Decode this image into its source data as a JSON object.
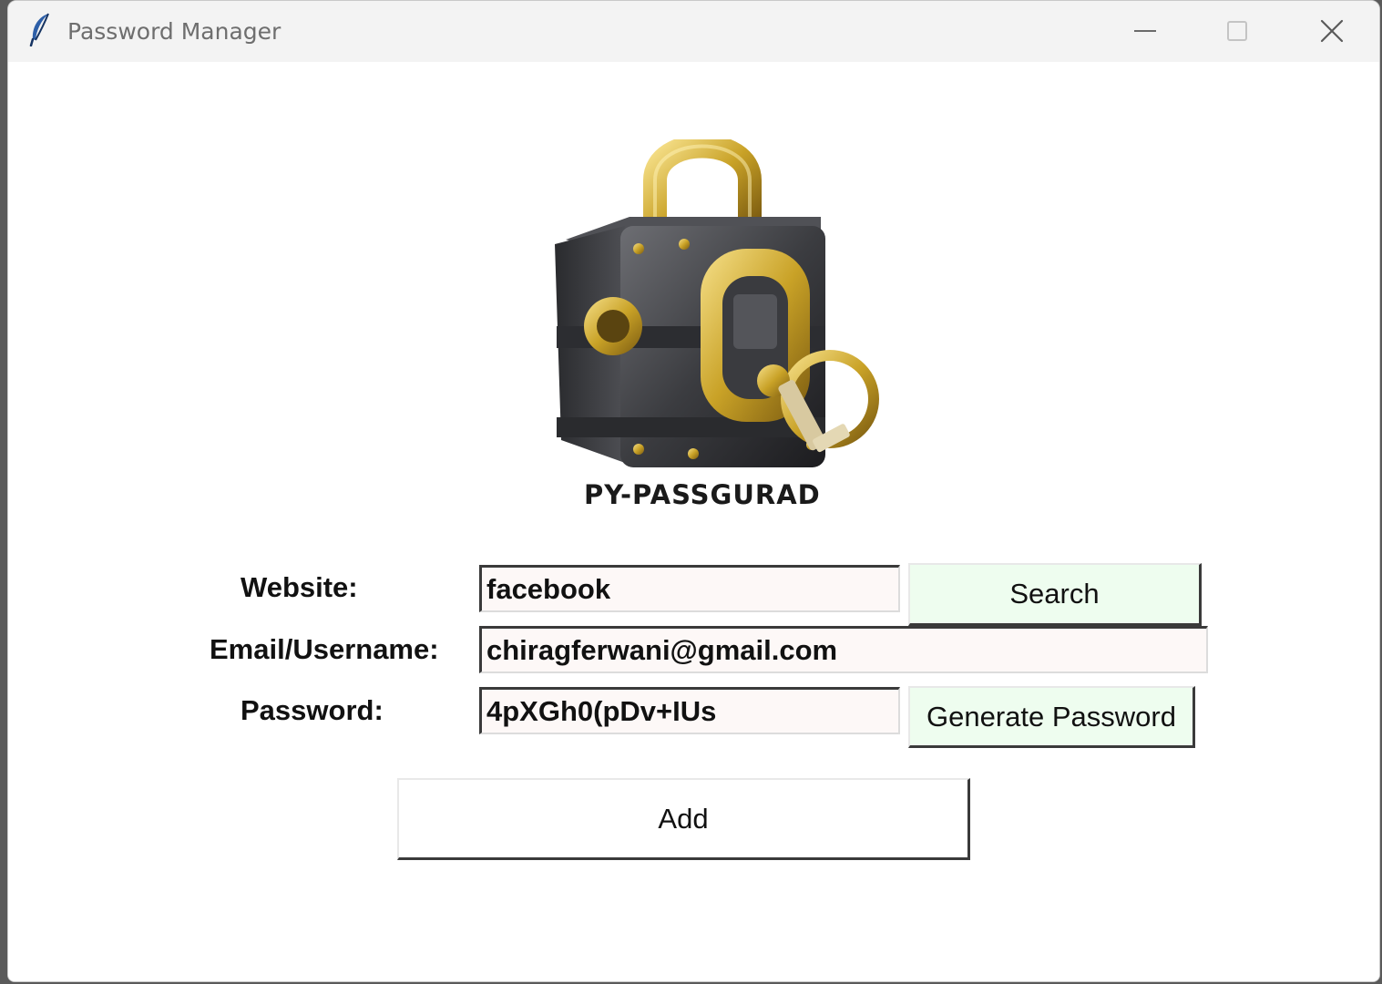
{
  "window": {
    "title": "Password Manager",
    "app_icon": "feather-icon",
    "controls": [
      "minimize-icon",
      "maximize-icon",
      "close-icon"
    ]
  },
  "branding": {
    "logo": "padlock-safe-logo",
    "name": "PY-PASSGURAD"
  },
  "form": {
    "website_label": "Website:",
    "website_value": "facebook",
    "email_label": "Email/Username:",
    "email_value": "chiragferwani@gmail.com",
    "password_label": "Password:",
    "password_value": "4pXGh0(pDv+IUs"
  },
  "buttons": {
    "search": "Search",
    "generate": "Generate Password",
    "add": "Add"
  },
  "colors": {
    "accent_button_bg": "#eefdef",
    "entry_bg": "#fdf8f7",
    "gold": "#c9a227",
    "metal": "#3b3c40"
  }
}
